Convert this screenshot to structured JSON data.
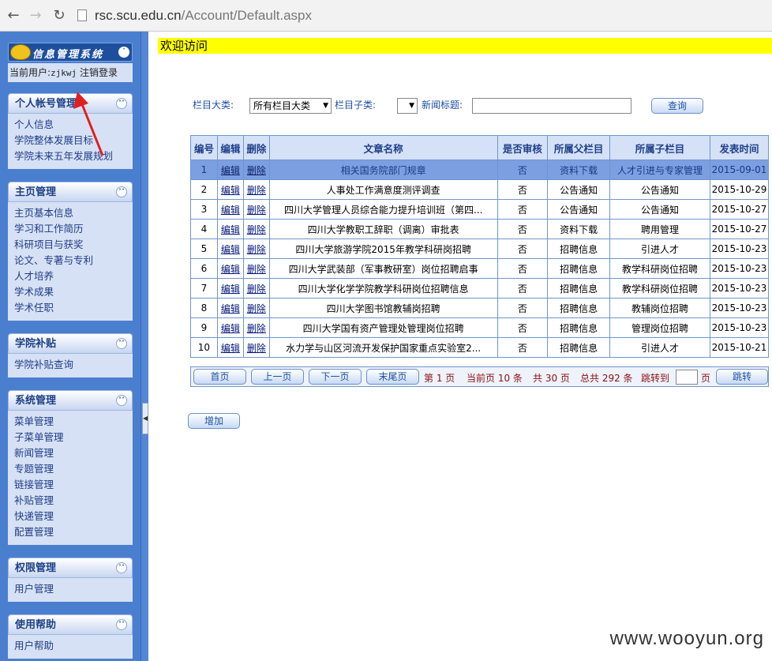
{
  "browser": {
    "url_host": "rsc.scu.edu.cn",
    "url_path": "/Account/Default.aspx"
  },
  "sidebar": {
    "logo_text": "信息管理系统",
    "current_user_label": "当前用户:",
    "current_user": "zjkwj",
    "logout": "注销登录",
    "panels": [
      {
        "title": "个人帐号管理",
        "items": [
          "个人信息",
          "学院整体发展目标",
          "学院未来五年发展规划"
        ]
      },
      {
        "title": "主页管理",
        "items": [
          "主页基本信息",
          "学习和工作简历",
          "科研项目与获奖",
          "论文、专著与专利",
          "人才培养",
          "学术成果",
          "学术任职"
        ]
      },
      {
        "title": "学院补贴",
        "items": [
          "学院补贴查询"
        ]
      },
      {
        "title": "系统管理",
        "items": [
          "菜单管理",
          "子菜单管理",
          "新闻管理",
          "专题管理",
          "链接管理",
          "补贴管理",
          "快递管理",
          "配置管理"
        ]
      },
      {
        "title": "权限管理",
        "items": [
          "用户管理"
        ]
      },
      {
        "title": "使用帮助",
        "items": [
          "用户帮助"
        ]
      }
    ]
  },
  "main": {
    "welcome": "欢迎访问",
    "search": {
      "category_label": "栏目大类:",
      "category_value": "所有栏目大类",
      "subcategory_label": "栏目子类:",
      "subcategory_value": "",
      "title_label": "新闻标题:",
      "title_value": "",
      "search_button": "查询"
    },
    "table": {
      "headers": [
        "编号",
        "编辑",
        "删除",
        "文章名称",
        "是否审核",
        "所属父栏目",
        "所属子栏目",
        "发表时间"
      ],
      "edit_label": "编辑",
      "delete_label": "删除",
      "rows": [
        {
          "id": "1",
          "name": "相关国务院部门规章",
          "audited": "否",
          "parent": "资料下载",
          "child": "人才引进与专家管理",
          "date": "2015-09-01"
        },
        {
          "id": "2",
          "name": "人事处工作满意度测评调查",
          "audited": "否",
          "parent": "公告通知",
          "child": "公告通知",
          "date": "2015-10-29"
        },
        {
          "id": "3",
          "name": "四川大学管理人员综合能力提升培训班（第四...",
          "audited": "否",
          "parent": "公告通知",
          "child": "公告通知",
          "date": "2015-10-27"
        },
        {
          "id": "4",
          "name": "四川大学教职工辞职（调离）审批表",
          "audited": "否",
          "parent": "资料下载",
          "child": "聘用管理",
          "date": "2015-10-27"
        },
        {
          "id": "5",
          "name": "四川大学旅游学院2015年教学科研岗招聘",
          "audited": "否",
          "parent": "招聘信息",
          "child": "引进人才",
          "date": "2015-10-23"
        },
        {
          "id": "6",
          "name": "四川大学武装部（军事教研室）岗位招聘启事",
          "audited": "否",
          "parent": "招聘信息",
          "child": "教学科研岗位招聘",
          "date": "2015-10-23"
        },
        {
          "id": "7",
          "name": "四川大学化学学院教学科研岗位招聘信息",
          "audited": "否",
          "parent": "招聘信息",
          "child": "教学科研岗位招聘",
          "date": "2015-10-23"
        },
        {
          "id": "8",
          "name": "四川大学图书馆教辅岗招聘",
          "audited": "否",
          "parent": "招聘信息",
          "child": "教辅岗位招聘",
          "date": "2015-10-23"
        },
        {
          "id": "9",
          "name": "四川大学国有资产管理处管理岗位招聘",
          "audited": "否",
          "parent": "招聘信息",
          "child": "管理岗位招聘",
          "date": "2015-10-23"
        },
        {
          "id": "10",
          "name": "水力学与山区河流开发保护国家重点实验室2...",
          "audited": "否",
          "parent": "招聘信息",
          "child": "引进人才",
          "date": "2015-10-21"
        }
      ]
    },
    "pager": {
      "first": "首页",
      "prev": "上一页",
      "next": "下一页",
      "last": "末尾页",
      "page_text": "第 1 页",
      "per_page_text": "当前页 10 条",
      "total_pages_text": "共 30 页",
      "total_items_text": "总共 292 条",
      "jump_label": "跳转到",
      "jump_unit": "页",
      "jump_button": "跳转"
    },
    "add_button": "增加"
  },
  "watermark": "www.wooyun.org",
  "colors": {
    "sidebar_bg": "#4a7fd0",
    "welcome_bar": "#ffff00",
    "selected_row": "#7b9fe0",
    "annotation_arrow": "#e02020"
  }
}
